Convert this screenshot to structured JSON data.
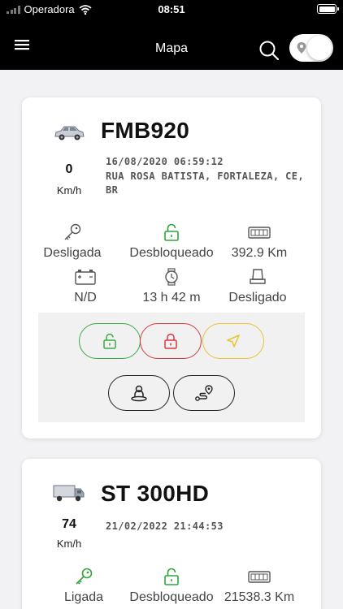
{
  "status_bar": {
    "carrier": "Operadora",
    "time": "08:51"
  },
  "app_bar": {
    "title": "Mapa"
  },
  "vehicles": [
    {
      "plate": "FMB920",
      "speed": "0",
      "speed_unit": "Km/h",
      "datetime": "16/08/2020 06:59:12",
      "address": "RUA ROSA BATISTA, FORTALEZA, CE, BR",
      "ignition": "Desligada",
      "lock_status": "Desbloqueado",
      "odometer": "392.9 Km",
      "battery": "N/D",
      "engine_hours": "13 h 42 m",
      "seat_status": "Desligado"
    },
    {
      "plate": "ST 300HD",
      "speed": "74",
      "speed_unit": "Km/h",
      "datetime": "21/02/2022 21:44:53",
      "ignition": "Ligada",
      "lock_status": "Desbloqueado",
      "odometer": "21538.3 Km"
    }
  ],
  "colors": {
    "unlock": "#3aaa47",
    "lock": "#d9393d",
    "locate": "#e7c430",
    "ignition_on": "#2ea53a"
  },
  "icons": [
    "menu-icon",
    "search-icon",
    "map-pin-icon",
    "car-icon",
    "truck-icon",
    "key-icon",
    "unlock-icon",
    "lock-icon",
    "odometer-icon",
    "battery-icon",
    "clock-icon",
    "seat-icon",
    "navigation-icon",
    "driver-icon",
    "route-icon"
  ]
}
